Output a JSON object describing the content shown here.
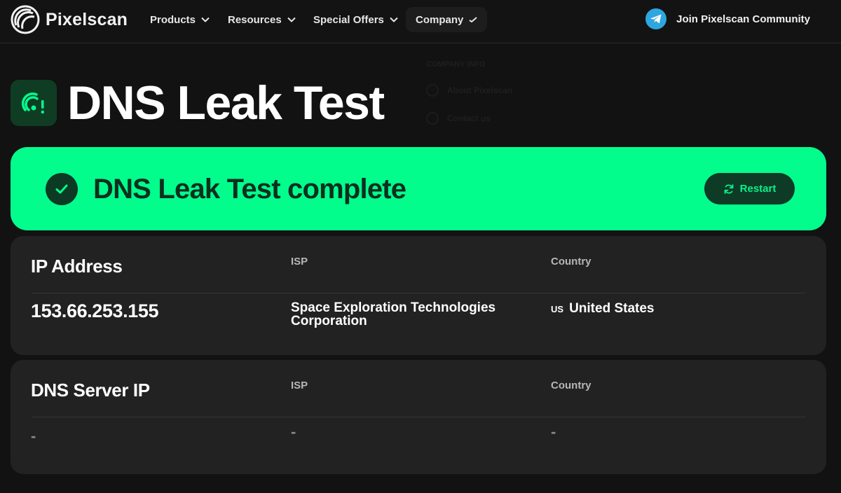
{
  "nav": {
    "brand": "Pixelscan",
    "items": [
      "Products",
      "Resources",
      "Special Offers",
      "Company"
    ],
    "community": "Join Pixelscan Community"
  },
  "dropdown_ghost": {
    "section": "COMPANY INFO",
    "items": [
      "About Pixelscan",
      "Contact us"
    ]
  },
  "page": {
    "title": "DNS Leak Test"
  },
  "banner": {
    "status": "DNS Leak Test complete",
    "restart": "Restart"
  },
  "ip_card": {
    "title": "IP Address",
    "isp_header": "ISP",
    "country_header": "Country",
    "ip": "153.66.253.155",
    "isp": "Space Exploration Technologies Corporation",
    "country_code": "US",
    "country": "United States"
  },
  "dns_card": {
    "title": "DNS Server IP",
    "isp_header": "ISP",
    "country_header": "Country",
    "ip": "-",
    "isp": "-",
    "country": "-"
  },
  "colors": {
    "accent": "#02fd8d",
    "dark_green": "#0e3b25",
    "background": "#121212",
    "card": "#222222",
    "telegram": "#2ea6e0"
  }
}
